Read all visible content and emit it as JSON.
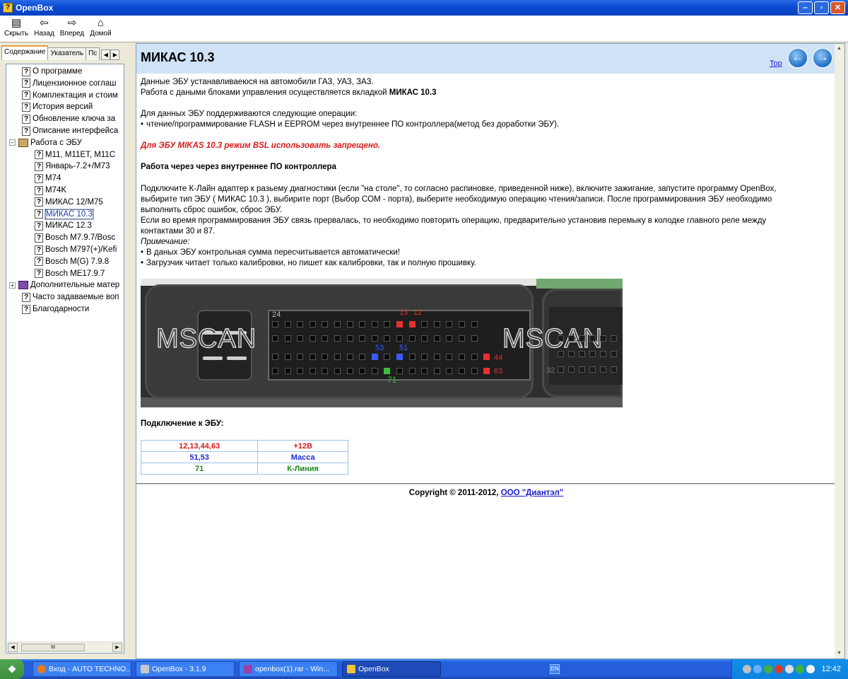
{
  "window": {
    "title": "OpenBox",
    "controls": {
      "minimize": "‒",
      "maximize": "▫",
      "close": "✕"
    }
  },
  "toolbar": {
    "buttons": [
      {
        "label": "Скрыть",
        "icon": "hide-icon"
      },
      {
        "label": "Назад",
        "icon": "back-arrow-icon"
      },
      {
        "label": "Вперед",
        "icon": "forward-arrow-icon"
      },
      {
        "label": "Домой",
        "icon": "home-icon"
      }
    ]
  },
  "sidebar": {
    "tabs": [
      "Содержание",
      "Указатель",
      "Пс"
    ],
    "tree": [
      {
        "label": "О программе",
        "level": 1,
        "icon": "help-page-icon"
      },
      {
        "label": "Лицензионное соглаш",
        "level": 1,
        "icon": "help-page-icon"
      },
      {
        "label": "Комплектация и стоим",
        "level": 1,
        "icon": "help-page-icon"
      },
      {
        "label": "История версий",
        "level": 1,
        "icon": "help-page-icon"
      },
      {
        "label": "Обновление ключа за",
        "level": 1,
        "icon": "help-page-icon"
      },
      {
        "label": "Описание интерфейса",
        "level": 1,
        "icon": "help-page-icon"
      },
      {
        "label": "Работа с ЭБУ",
        "level": 0,
        "icon": "open-book-icon",
        "expander": "−"
      },
      {
        "label": "M11, M11ET, M11C",
        "level": 2,
        "icon": "help-page-icon"
      },
      {
        "label": "Январь-7.2+/M73",
        "level": 2,
        "icon": "help-page-icon"
      },
      {
        "label": "M74",
        "level": 2,
        "icon": "help-page-icon"
      },
      {
        "label": "M74K",
        "level": 2,
        "icon": "help-page-icon"
      },
      {
        "label": "МИКАС 12/M75",
        "level": 2,
        "icon": "help-page-icon"
      },
      {
        "label": "МИКАС 10.3",
        "level": 2,
        "icon": "help-page-icon",
        "selected": true
      },
      {
        "label": "МИКАС 12.3",
        "level": 2,
        "icon": "help-page-icon"
      },
      {
        "label": "Bosch M7.9.7/Bosc",
        "level": 2,
        "icon": "help-page-icon"
      },
      {
        "label": "Bosch M797(+)/Kefi",
        "level": 2,
        "icon": "help-page-icon"
      },
      {
        "label": "Bosch M(G) 7.9.8",
        "level": 2,
        "icon": "help-page-icon"
      },
      {
        "label": "Bosch ME17.9.7",
        "level": 2,
        "icon": "help-page-icon"
      },
      {
        "label": "Дополнительные матер",
        "level": 0,
        "icon": "closed-book-icon",
        "expander": "+"
      },
      {
        "label": "Часто задаваемые воп",
        "level": 1,
        "icon": "help-page-icon"
      },
      {
        "label": "Благодарности",
        "level": 1,
        "icon": "help-page-icon"
      }
    ]
  },
  "article": {
    "title": "МИКАС 10.3",
    "top_link": "Top",
    "intro_line1": "Данные ЭБУ устанавливаеюся на автомобили ГАЗ, УАЗ, ЗАЗ.",
    "intro_line2_prefix": "Работа с даными блоками управления осуществляется вкладкой ",
    "intro_line2_bold": "МИКАС 10.3",
    "ops_heading": "Для данных ЭБУ поддерживаются следующие операции:",
    "ops_items": [
      "чтение/программирование FLASH и EEPROM через внутреннее ПО контроллера(метод без доработки ЭБУ)."
    ],
    "warning": "Для ЭБУ MIKAS 10.3 режим  BSL использовать запрещено.",
    "section_heading": "Работа через через внутреннее ПО контроллера",
    "para_lines": [
      "Подключите К-Лайн адаптер к разьему диагностики (если \"на столе\", то согласно распиновке, приведенной ниже), включите зажигание, запустите программу OpenBox,",
      "выбирите тип ЭБУ ( МИКАС 10.3 ), выбирите порт (Выбор COM - порта), выберите необходимую операцию чтения/записи. После программирования ЭБУ необходимо",
      "выполнить сброс ошибок, сброс ЭБУ.",
      "Если во время программирования ЭБУ связь прервалась, то необходимо повторить операцию, предварительно установив перемыку в колодке главного реле между",
      "контактами 30 и 87."
    ],
    "note_label": "Примечание:",
    "note_items": [
      "В даных ЭБУ контрольная сумма пересчитывается автоматически!",
      "Загрузчик читает только калибровки, но пишет как калибровки, так и полную прошивку."
    ],
    "image": {
      "left_label": "MSCAN",
      "right_label": "MSCAN",
      "pin_labels": [
        {
          "text": "24",
          "color": "#bbbbbb"
        },
        {
          "text": "13",
          "color": "#e83030"
        },
        {
          "text": "12",
          "color": "#e83030"
        },
        {
          "text": "53",
          "color": "#3a5aff"
        },
        {
          "text": "51",
          "color": "#3a5aff"
        },
        {
          "text": "44",
          "color": "#e83030"
        },
        {
          "text": "63",
          "color": "#e83030"
        },
        {
          "text": "71",
          "color": "#3cbf3c"
        },
        {
          "text": "32",
          "color": "#777777"
        }
      ]
    },
    "connection_heading": "Подключение к ЭБУ:",
    "connection_table": [
      {
        "pins": "12,13,44,63",
        "signal": "+12В",
        "color": "#D41C1C"
      },
      {
        "pins": "51,53",
        "signal": "Масса",
        "color": "#1C2BD4"
      },
      {
        "pins": "71",
        "signal": "К-Линия",
        "color": "#1A8A1A"
      }
    ],
    "copyright_text": "Copyright © 2011-2012, ",
    "copyright_link": "ООО \"Диантэл\""
  },
  "taskbar": {
    "tasks": [
      {
        "label": "Вход - AUTO TECHNO...",
        "icon": "firefox-icon"
      },
      {
        "label": "OpenBox - 3.1.9",
        "icon": "openbox-icon"
      },
      {
        "label": "openbox(1).rar - Win...",
        "icon": "winrar-icon"
      },
      {
        "label": "OpenBox",
        "icon": "help-icon",
        "active": true
      }
    ],
    "language": "EN",
    "clock": "12:42"
  },
  "colors": {
    "header_bg": "#D0E2F5",
    "warning_red": "#D41C1C",
    "link_blue": "#1a1ad0"
  }
}
